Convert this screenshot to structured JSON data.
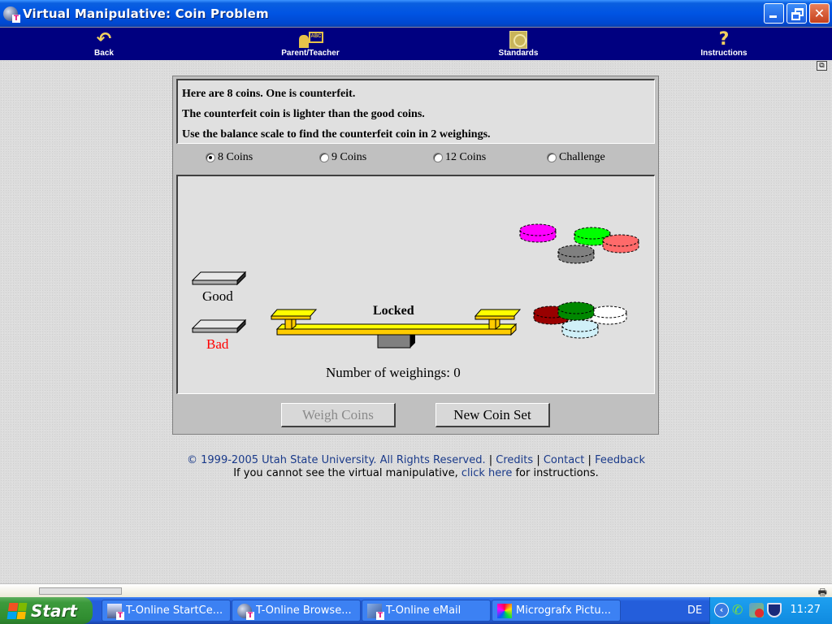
{
  "window": {
    "title": "Virtual Manipulative: Coin Problem",
    "controls": [
      "minimize",
      "restore",
      "close"
    ]
  },
  "nav": {
    "items": [
      {
        "label": "Back",
        "icon": "back-arrow-icon"
      },
      {
        "label": "Parent/Teacher",
        "icon": "teacher-icon"
      },
      {
        "label": "Standards",
        "icon": "standards-icon"
      },
      {
        "label": "Instructions",
        "icon": "question-icon"
      }
    ]
  },
  "applet": {
    "instructions": [
      "Here are 8 coins. One is counterfeit.",
      "The counterfeit coin is lighter than the good coins.",
      "Use the balance scale to find the counterfeit coin in 2 weighings."
    ],
    "modes": [
      {
        "label": "8 Coins",
        "checked": true
      },
      {
        "label": "9 Coins",
        "checked": false
      },
      {
        "label": "12 Coins",
        "checked": false
      },
      {
        "label": "Challenge",
        "checked": false
      }
    ],
    "stage": {
      "good_label": "Good",
      "bad_label": "Bad",
      "scale_status": "Locked",
      "weighings_text": "Number of weighings: 0",
      "weighings_count": 0,
      "coins": [
        {
          "color": "#ff00ff",
          "group": "top"
        },
        {
          "color": "#00ff00",
          "group": "top"
        },
        {
          "color": "#ff6a6a",
          "group": "top"
        },
        {
          "color": "#808080",
          "group": "top"
        },
        {
          "color": "#990000",
          "group": "bottom"
        },
        {
          "color": "#ffffff",
          "group": "bottom"
        },
        {
          "color": "#d0f0f8",
          "group": "bottom"
        },
        {
          "color": "#008800",
          "group": "bottom"
        }
      ],
      "colors": {
        "scale_yellow": "#ffff00",
        "scale_gold": "#ffcc00",
        "bad_label": "#ff0000"
      }
    },
    "buttons": {
      "weigh": {
        "label": "Weigh Coins",
        "enabled": false
      },
      "new_set": {
        "label": "New Coin Set",
        "enabled": true
      }
    }
  },
  "footer": {
    "copyright": "© 1999-2005 Utah State University. All Rights Reserved.",
    "links": [
      "Credits",
      "Contact",
      "Feedback"
    ],
    "help_prefix": "If you cannot see the virtual manipulative,",
    "help_link": "click here",
    "help_suffix": "for instructions."
  },
  "taskbar": {
    "start_label": "Start",
    "tasks": [
      {
        "label": "T-Online StartCe...",
        "icon": "start-center"
      },
      {
        "label": "T-Online Browse...",
        "icon": "globe"
      },
      {
        "label": "T-Online eMail",
        "icon": "mail"
      },
      {
        "label": "Micrografx Pictu...",
        "icon": "micrografx"
      }
    ],
    "language": "DE",
    "clock": "11:27"
  }
}
